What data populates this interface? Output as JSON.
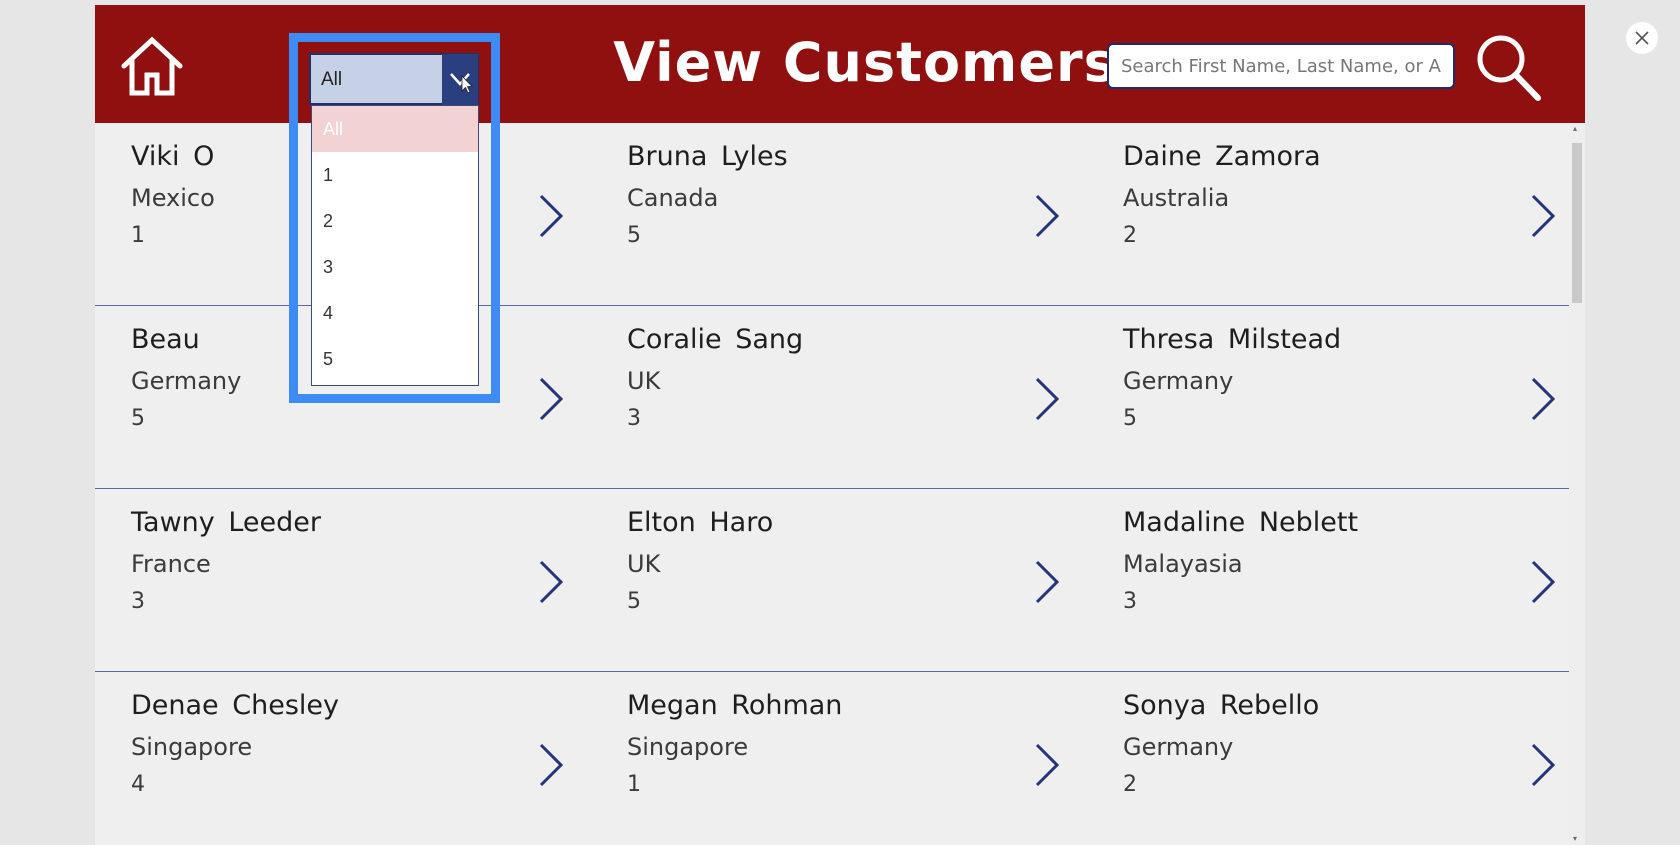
{
  "header": {
    "title": "View Customers",
    "search_placeholder": "Search First Name, Last Name, or Age",
    "home_icon": "home-icon",
    "search_icon": "magnifier-icon"
  },
  "filter": {
    "selected": "All",
    "options": [
      "All",
      "1",
      "2",
      "3",
      "4",
      "5"
    ]
  },
  "rows": [
    [
      {
        "name": "Viki O",
        "country": "Mexico",
        "age": "1"
      },
      {
        "name": "Bruna Lyles",
        "country": "Canada",
        "age": "5"
      },
      {
        "name": "Daine Zamora",
        "country": "Australia",
        "age": "2"
      }
    ],
    [
      {
        "name": "Beau",
        "country": "Germany",
        "age": "5"
      },
      {
        "name": "Coralie Sang",
        "country": "UK",
        "age": "3"
      },
      {
        "name": "Thresa Milstead",
        "country": "Germany",
        "age": "5"
      }
    ],
    [
      {
        "name": "Tawny Leeder",
        "country": "France",
        "age": "3"
      },
      {
        "name": "Elton Haro",
        "country": "UK",
        "age": "5"
      },
      {
        "name": "Madaline Neblett",
        "country": "Malayasia",
        "age": "3"
      }
    ],
    [
      {
        "name": "Denae Chesley",
        "country": "Singapore",
        "age": "4"
      },
      {
        "name": "Megan Rohman",
        "country": "Singapore",
        "age": "1"
      },
      {
        "name": "Sonya Rebello",
        "country": "Germany",
        "age": "2"
      }
    ]
  ],
  "colors": {
    "header_bg": "#901010",
    "accent_navy": "#22306a",
    "highlight_blue": "#3d8bf5",
    "selected_option_bg": "#f2d2d2"
  }
}
